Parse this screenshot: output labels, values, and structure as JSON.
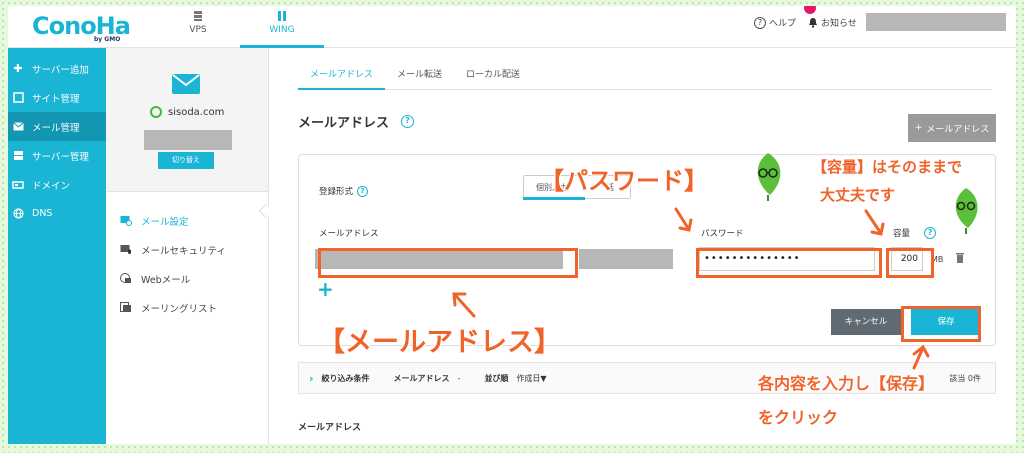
{
  "brand": {
    "logo": "ConoHa",
    "sub": "by GMO"
  },
  "topnav": [
    {
      "label": "VPS",
      "icon": "server-icon"
    },
    {
      "label": "WING",
      "icon": "wing-icon"
    }
  ],
  "header": {
    "help": "ヘルプ",
    "notice": "お知らせ"
  },
  "sidebar": {
    "items": [
      {
        "label": "サーバー追加",
        "icon": "plus-icon"
      },
      {
        "label": "サイト管理",
        "icon": "window-icon"
      },
      {
        "label": "メール管理",
        "icon": "envelope-icon"
      },
      {
        "label": "サーバー管理",
        "icon": "server-icon"
      },
      {
        "label": "ドメイン",
        "icon": "domain-icon"
      },
      {
        "label": "DNS",
        "icon": "globe-icon"
      }
    ]
  },
  "domain_panel": {
    "domain": "sisoda.com",
    "switch_label": "切り替え",
    "menu": [
      {
        "label": "メール設定",
        "icon": "mail-settings-icon"
      },
      {
        "label": "メールセキュリティ",
        "icon": "mail-security-icon"
      },
      {
        "label": "Webメール",
        "icon": "webmail-icon"
      },
      {
        "label": "メーリングリスト",
        "icon": "mailing-list-icon"
      }
    ]
  },
  "main": {
    "tabs": [
      "メールアドレス",
      "メール転送",
      "ローカル配送"
    ],
    "title": "メールアドレス",
    "add_button": "メールアドレス",
    "form": {
      "register_label": "登録形式",
      "register_option": "個別入力",
      "register_option_tail": "括",
      "address_label": "メールアドレス",
      "password_label": "パスワード",
      "password_value": "••••••••••••••",
      "capacity_label": "容量",
      "capacity_value": "200",
      "capacity_unit": "MB",
      "cancel": "キャンセル",
      "save": "保存"
    },
    "filter": {
      "label": "絞り込み条件",
      "field": "メールアドレス",
      "field_value": "-",
      "sort_label": "並び順",
      "sort_value": "作成日▼",
      "count": "該当 0件"
    },
    "list_header": "メールアドレス"
  },
  "annotations": {
    "password": "【パスワード】",
    "capacity_1": "【容量】はそのままで",
    "capacity_2": "大丈夫です",
    "address": "【メールアドレス】",
    "save_1": "各内容を入力し【保存】",
    "save_2": "をクリック"
  },
  "colors": {
    "accent": "#1ab5d4",
    "annotation": "#f0642c",
    "leaf": "#5bbf3a"
  }
}
